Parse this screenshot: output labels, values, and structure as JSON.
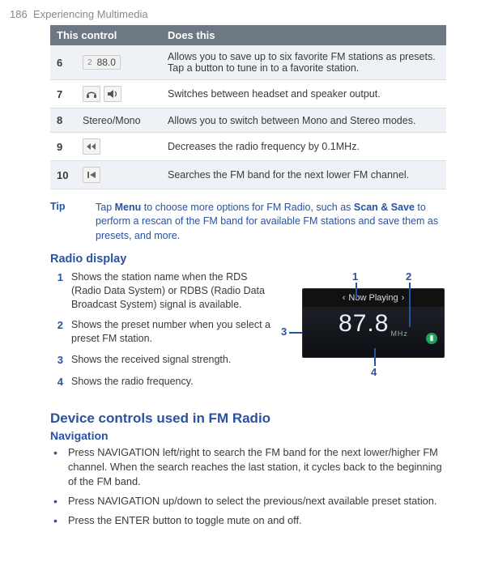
{
  "header": {
    "page_num": "186",
    "title": "Experiencing Multimedia"
  },
  "table": {
    "head": {
      "c1": "This control",
      "c2": "Does this"
    },
    "rows": [
      {
        "n": "6",
        "ctrl_num": "2",
        "ctrl_freq": "88.0",
        "desc": "Allows you to save up to six favorite FM stations as presets. Tap a button to tune in to a favorite station."
      },
      {
        "n": "7",
        "desc": "Switches between headset and speaker output."
      },
      {
        "n": "8",
        "ctrl_text": "Stereo/Mono",
        "desc": "Allows you to switch between Mono and Stereo modes."
      },
      {
        "n": "9",
        "desc": "Decreases the radio frequency by 0.1MHz."
      },
      {
        "n": "10",
        "desc": "Searches the FM band for the next lower FM channel."
      }
    ]
  },
  "tip": {
    "label": "Tip",
    "pre": "Tap ",
    "b1": "Menu",
    "mid": " to choose more options for FM Radio, such as ",
    "b2": "Scan & Save",
    "post": " to perform a rescan of the FM band for available FM stations and save them as presets, and more."
  },
  "radio": {
    "heading": "Radio display",
    "items": [
      {
        "n": "1",
        "t": "Shows the station name when the RDS (Radio Data System) or RDBS (Radio Data Broadcast System) signal is available."
      },
      {
        "n": "2",
        "t": "Shows the preset number when you select a preset FM station."
      },
      {
        "n": "3",
        "t": "Shows the received signal strength."
      },
      {
        "n": "4",
        "t": "Shows the radio frequency."
      }
    ],
    "figure": {
      "now_playing": "Now Playing",
      "freq": "87.8",
      "unit": "MHz",
      "labels": {
        "l1": "1",
        "l2": "2",
        "l3": "3",
        "l4": "4"
      }
    }
  },
  "device": {
    "heading": "Device controls used in FM Radio",
    "nav_heading": "Navigation",
    "bullets": [
      "Press NAVIGATION left/right to search the FM band for the next lower/higher FM channel. When the search reaches the last station, it cycles back to the beginning of the FM band.",
      "Press NAVIGATION up/down to select the previous/next available preset station.",
      "Press the ENTER button to toggle mute on and off."
    ]
  }
}
